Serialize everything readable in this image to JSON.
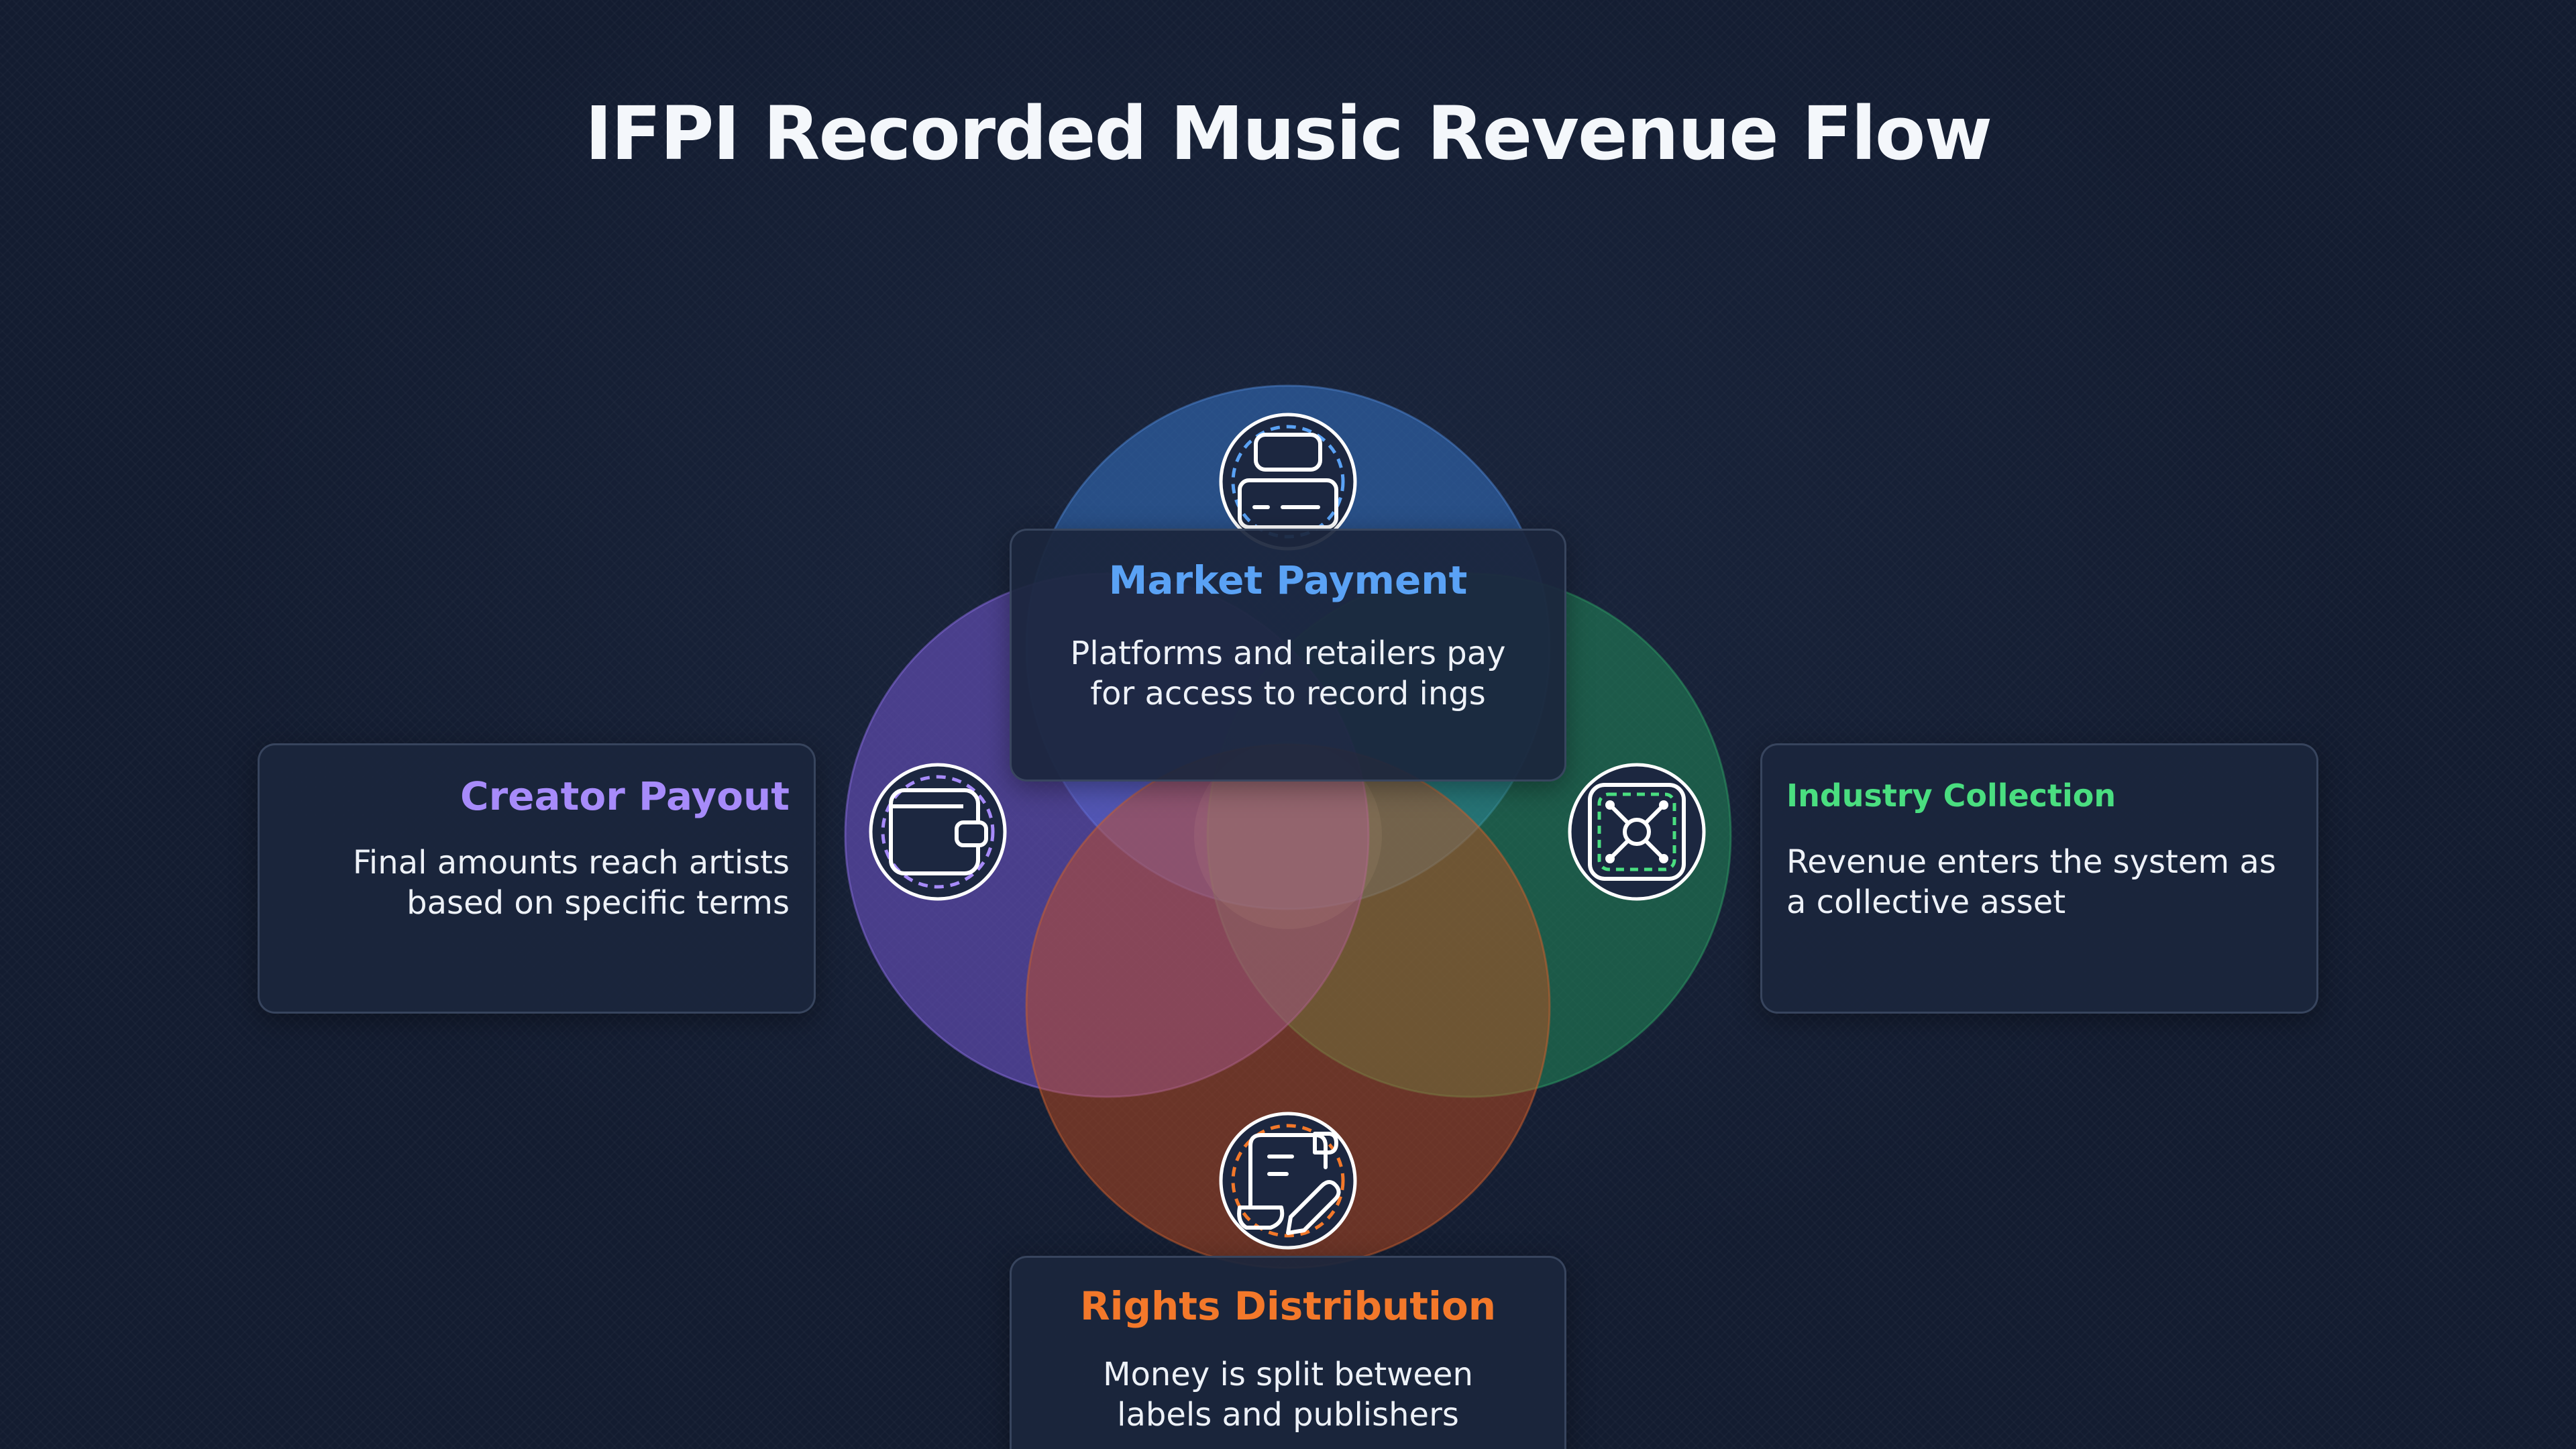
{
  "title": "IFPI Recorded Music Revenue Flow",
  "colors": {
    "background": "#131c30",
    "market": "#5aa2f5",
    "industry": "#4ade80",
    "rights": "#f3782a",
    "creator": "#a78bfa",
    "card_background": "#1b263c"
  },
  "nodes": {
    "market": {
      "title": "Market Payment",
      "description": "Platforms and retailers pay for access to record ings",
      "icon": "credit-card-icon"
    },
    "industry": {
      "title": "Industry Collection",
      "description": "Revenue enters the system as a collective asset",
      "icon": "network-hub-icon"
    },
    "rights": {
      "title": "Rights Distribution",
      "description": "Money is split between labels and publishers",
      "icon": "contract-document-icon"
    },
    "creator": {
      "title": "Creator Payout",
      "description": "Final amounts reach artists based on specific terms",
      "icon": "wallet-icon"
    }
  }
}
